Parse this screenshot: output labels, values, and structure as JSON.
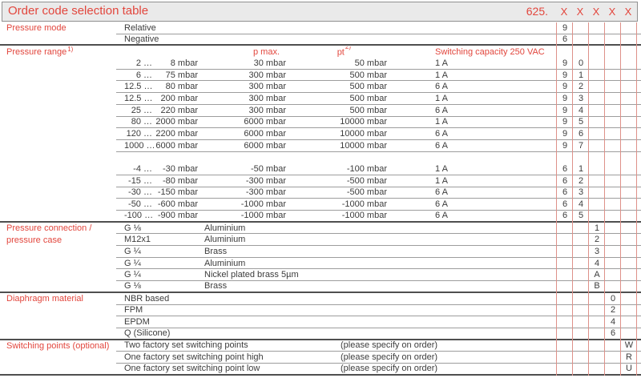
{
  "title": {
    "text": "Order code selection table",
    "model": "625.",
    "x_marks": [
      "X",
      "X",
      "X",
      "X",
      "X"
    ]
  },
  "colors": {
    "accent_red": "#e2463d",
    "code_column_rule_red": "#de9189",
    "row_rule_gray": "#9d9d9d",
    "section_rule_dark": "#4f4f4f",
    "titlebar_background": "#eaeaea"
  },
  "rows": [
    {
      "type": "mode",
      "label": "Pressure mode",
      "text": "Relative",
      "codes": [
        "9",
        "",
        "",
        "",
        ""
      ],
      "line": "row"
    },
    {
      "type": "mode",
      "text": "Negative",
      "codes": [
        "6",
        "",
        "",
        "",
        ""
      ],
      "line": "section"
    },
    {
      "type": "rangehdr",
      "label": "Pressure range",
      "label_sup": "1)",
      "pmax": "p max.",
      "pt": "pt",
      "pt_sup": "2)",
      "cap": "Switching capacity 250 VAC",
      "codes": [
        "",
        "",
        "",
        "",
        ""
      ],
      "line": "none"
    },
    {
      "type": "range",
      "low": "2 …",
      "high": "8 mbar",
      "pmax": "30 mbar",
      "pt": "50 mbar",
      "cap": "1 A",
      "codes": [
        "9",
        "0",
        "",
        "",
        ""
      ],
      "line": "row"
    },
    {
      "type": "range",
      "low": "6 …",
      "high": "75 mbar",
      "pmax": "300 mbar",
      "pt": "500 mbar",
      "cap": "1 A",
      "codes": [
        "9",
        "1",
        "",
        "",
        ""
      ],
      "line": "row"
    },
    {
      "type": "range",
      "low": "12.5 …",
      "high": "80 mbar",
      "pmax": "300 mbar",
      "pt": "500 mbar",
      "cap": "6 A",
      "codes": [
        "9",
        "2",
        "",
        "",
        ""
      ],
      "line": "row"
    },
    {
      "type": "range",
      "low": "12.5 …",
      "high": "200 mbar",
      "pmax": "300 mbar",
      "pt": "500 mbar",
      "cap": "1 A",
      "codes": [
        "9",
        "3",
        "",
        "",
        ""
      ],
      "line": "row"
    },
    {
      "type": "range",
      "low": "25 …",
      "high": "220 mbar",
      "pmax": "300 mbar",
      "pt": "500 mbar",
      "cap": "6 A",
      "codes": [
        "9",
        "4",
        "",
        "",
        ""
      ],
      "line": "row"
    },
    {
      "type": "range",
      "low": "80 …",
      "high": "2000 mbar",
      "pmax": "6000 mbar",
      "pt": "10000 mbar",
      "cap": "1 A",
      "codes": [
        "9",
        "5",
        "",
        "",
        ""
      ],
      "line": "row"
    },
    {
      "type": "range",
      "low": "120 …",
      "high": "2200 mbar",
      "pmax": "6000 mbar",
      "pt": "10000 mbar",
      "cap": "6 A",
      "codes": [
        "9",
        "6",
        "",
        "",
        ""
      ],
      "line": "row"
    },
    {
      "type": "range",
      "low": "1000 …",
      "high": "6000 mbar",
      "pmax": "6000 mbar",
      "pt": "10000 mbar",
      "cap": "6 A",
      "codes": [
        "9",
        "7",
        "",
        "",
        ""
      ],
      "line": "row"
    },
    {
      "type": "gap",
      "codes": [
        "",
        "",
        "",
        "",
        ""
      ],
      "line": "none"
    },
    {
      "type": "range",
      "low": "-4 …",
      "high": "-30 mbar",
      "pmax": "-50 mbar",
      "pt": "-100 mbar",
      "cap": "1 A",
      "codes": [
        "6",
        "1",
        "",
        "",
        ""
      ],
      "line": "row"
    },
    {
      "type": "range",
      "low": "-15 …",
      "high": "-80 mbar",
      "pmax": "-300 mbar",
      "pt": "-500 mbar",
      "cap": "1 A",
      "codes": [
        "6",
        "2",
        "",
        "",
        ""
      ],
      "line": "row"
    },
    {
      "type": "range",
      "low": "-30 …",
      "high": "-150 mbar",
      "pmax": "-300 mbar",
      "pt": "-500 mbar",
      "cap": "6 A",
      "codes": [
        "6",
        "3",
        "",
        "",
        ""
      ],
      "line": "row"
    },
    {
      "type": "range",
      "low": "-50 …",
      "high": "-600 mbar",
      "pmax": "-1000 mbar",
      "pt": "-1000 mbar",
      "cap": "6 A",
      "codes": [
        "6",
        "4",
        "",
        "",
        ""
      ],
      "line": "row"
    },
    {
      "type": "range",
      "low": "-100 …",
      "high": "-900 mbar",
      "pmax": "-1000 mbar",
      "pt": "-1000 mbar",
      "cap": "6 A",
      "codes": [
        "6",
        "5",
        "",
        "",
        ""
      ],
      "line": "section"
    },
    {
      "type": "conn",
      "label": "Pressure connection /",
      "thread": "G ⅛",
      "material": "Aluminium",
      "codes": [
        "",
        "",
        "1",
        "",
        ""
      ],
      "line": "row"
    },
    {
      "type": "conn",
      "label": "pressure case",
      "thread": "M12x1",
      "material": "Aluminium",
      "codes": [
        "",
        "",
        "2",
        "",
        ""
      ],
      "line": "row"
    },
    {
      "type": "conn",
      "thread": "G ¼",
      "material": "Brass",
      "codes": [
        "",
        "",
        "3",
        "",
        ""
      ],
      "line": "row"
    },
    {
      "type": "conn",
      "thread": "G ¼",
      "material": "Aluminium",
      "codes": [
        "",
        "",
        "4",
        "",
        ""
      ],
      "line": "row"
    },
    {
      "type": "conn",
      "thread": "G ¼",
      "material": "Nickel plated brass 5µm",
      "codes": [
        "",
        "",
        "A",
        "",
        ""
      ],
      "line": "row"
    },
    {
      "type": "conn",
      "thread": "G ⅛",
      "material": "Brass",
      "codes": [
        "",
        "",
        "B",
        "",
        ""
      ],
      "line": "section"
    },
    {
      "type": "mat",
      "label": "Diaphragm material",
      "text": "NBR based",
      "codes": [
        "",
        "",
        "",
        "0",
        ""
      ],
      "line": "row"
    },
    {
      "type": "mat",
      "text": "FPM",
      "codes": [
        "",
        "",
        "",
        "2",
        ""
      ],
      "line": "row"
    },
    {
      "type": "mat",
      "text": "EPDM",
      "codes": [
        "",
        "",
        "",
        "4",
        ""
      ],
      "line": "row"
    },
    {
      "type": "mat",
      "text": "Q (Silicone)",
      "codes": [
        "",
        "",
        "",
        "6",
        ""
      ],
      "line": "section"
    },
    {
      "type": "sw",
      "label": "Switching points (optional)",
      "text": "Two factory set switching points",
      "note": "(please specify on order)",
      "codes": [
        "",
        "",
        "",
        "",
        "W"
      ],
      "line": "row"
    },
    {
      "type": "sw",
      "text": "One factory set switching point high",
      "note": "(please specify on order)",
      "codes": [
        "",
        "",
        "",
        "",
        "R"
      ],
      "line": "row"
    },
    {
      "type": "sw",
      "text": "One factory set switching point low",
      "note": "(please specify on order)",
      "codes": [
        "",
        "",
        "",
        "",
        "U"
      ],
      "line": "section"
    }
  ]
}
